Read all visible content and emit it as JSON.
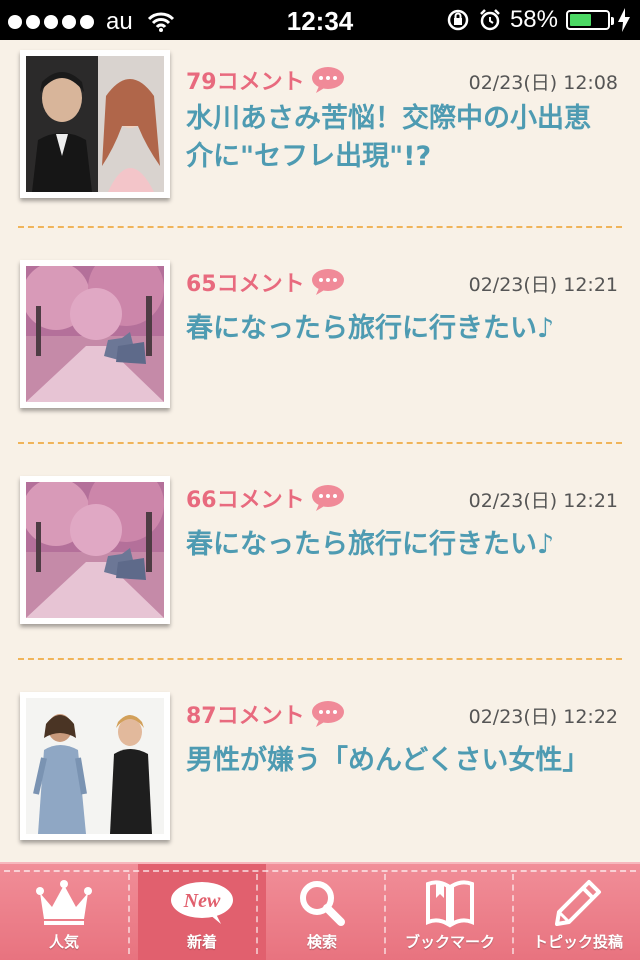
{
  "status_bar": {
    "carrier": "au",
    "time": "12:34",
    "battery_percent": "58%",
    "battery_level": 0.58
  },
  "items": [
    {
      "comments": "79コメント",
      "date": "02/23(日) 12:08",
      "title": "水川あさみ苦悩！交際中の小出恵介に\"セフレ出現\"!?"
    },
    {
      "comments": "65コメント",
      "date": "02/23(日) 12:21",
      "title": "春になったら旅行に行きたい♪"
    },
    {
      "comments": "66コメント",
      "date": "02/23(日) 12:21",
      "title": "春になったら旅行に行きたい♪"
    },
    {
      "comments": "87コメント",
      "date": "02/23(日) 12:22",
      "title": "男性が嫌う「めんどくさい女性」"
    }
  ],
  "tabs": [
    {
      "label": "人気",
      "icon": "crown-icon"
    },
    {
      "label": "新着",
      "icon": "new-badge-icon",
      "badge": "New"
    },
    {
      "label": "検索",
      "icon": "search-icon"
    },
    {
      "label": "ブックマーク",
      "icon": "book-icon"
    },
    {
      "label": "トピック投稿",
      "icon": "pencil-icon"
    }
  ],
  "active_tab": 1
}
